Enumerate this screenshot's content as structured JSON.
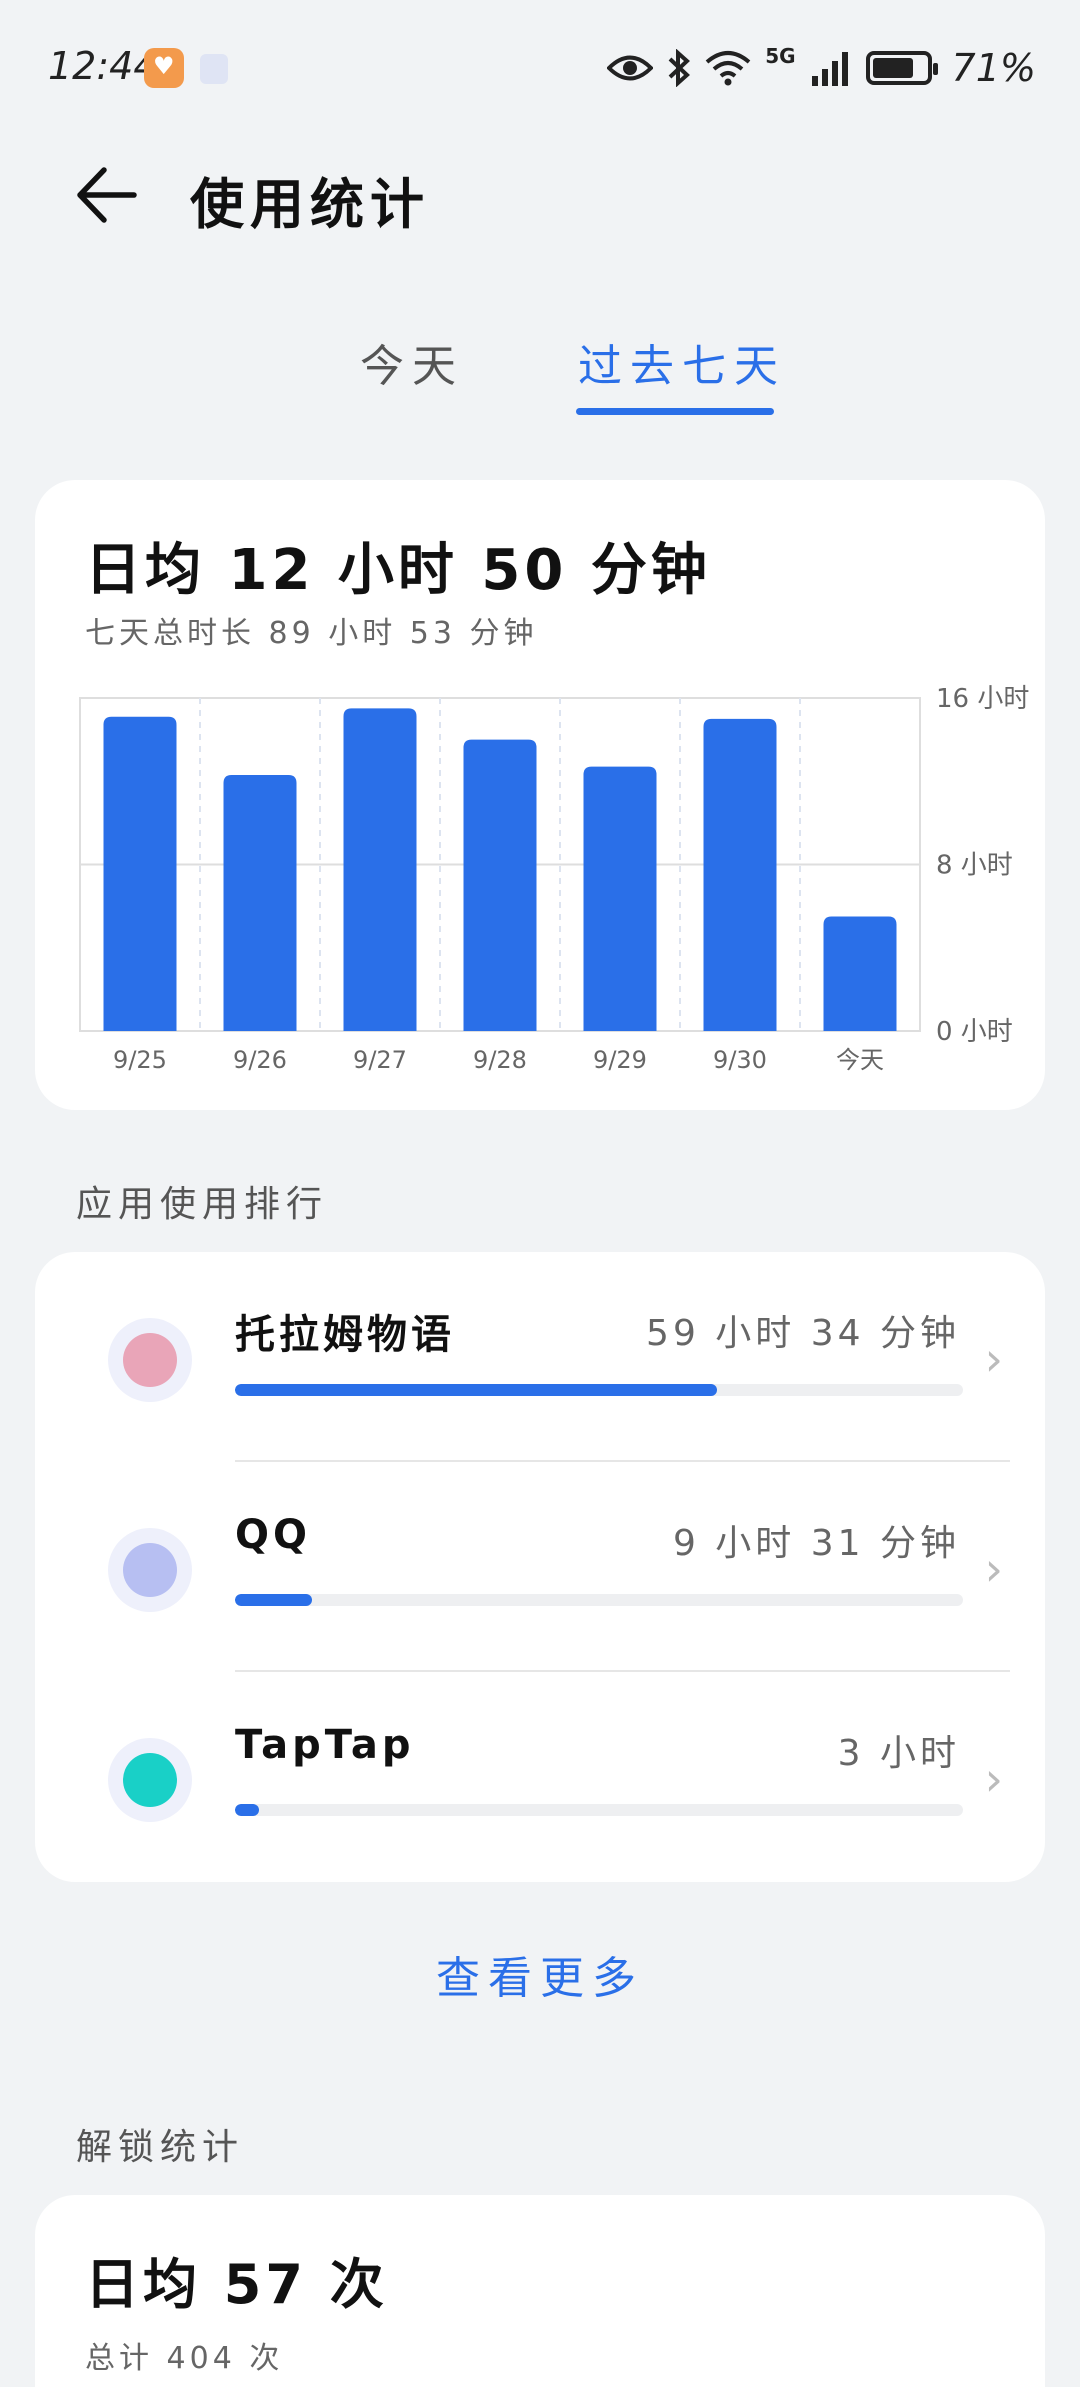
{
  "status_bar": {
    "time": "12:44",
    "network": "5G",
    "battery": "71%",
    "icons": [
      "app-notification-icon",
      "shield-icon",
      "eye-icon",
      "bluetooth-icon",
      "wifi-icon",
      "signal-icon",
      "battery-icon"
    ]
  },
  "header": {
    "title": "使用统计",
    "back_icon": "arrow-left-icon"
  },
  "tabs": [
    {
      "label": "今天",
      "active": false
    },
    {
      "label": "过去七天",
      "active": true
    }
  ],
  "usage": {
    "daily_avg": "日均  12 小时 50 分钟",
    "total": "七天总时长  89 小时 53 分钟"
  },
  "chart_data": {
    "type": "bar",
    "categories": [
      "9/25",
      "9/26",
      "9/27",
      "9/28",
      "9/29",
      "9/30",
      "今天"
    ],
    "values": [
      15.1,
      12.3,
      15.5,
      14.0,
      12.7,
      15.0,
      5.5
    ],
    "y_tick_labels": [
      "0 小时",
      "8 小时",
      "16 小时"
    ],
    "y_ticks": [
      0,
      8,
      16
    ],
    "ylim": [
      0,
      16
    ],
    "color": "#2a6fe8",
    "grid": true
  },
  "ranking": {
    "section_title": "应用使用排行",
    "apps": [
      {
        "name": "托拉姆物语",
        "time": "59 小时 34 分钟",
        "fraction": 0.662,
        "icon": "toram-app-icon",
        "icon_color": "#e9a5b8"
      },
      {
        "name": "QQ",
        "time": "9 小时 31 分钟",
        "fraction": 0.106,
        "icon": "qq-app-icon",
        "icon_color": "#b7bff2"
      },
      {
        "name": "TapTap",
        "time": "3 小时",
        "fraction": 0.033,
        "icon": "taptap-app-icon",
        "icon_color": "#19d0c7"
      }
    ],
    "see_more": "查看更多"
  },
  "unlock": {
    "section_title": "解锁统计",
    "daily_avg": "日均  57 次",
    "total": "总计  404 次"
  },
  "colors": {
    "accent": "#2a6fe8",
    "background": "#f1f3f5",
    "card": "#ffffff"
  }
}
